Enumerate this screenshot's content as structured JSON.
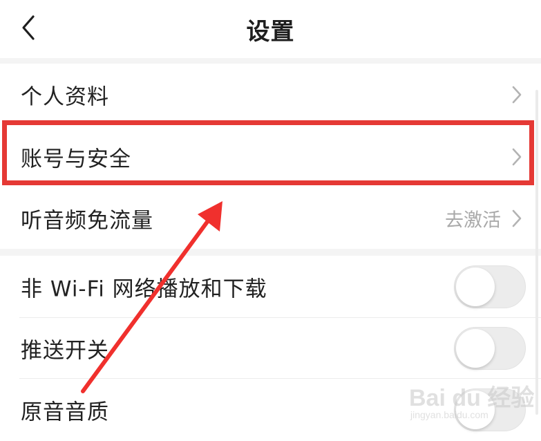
{
  "header": {
    "title": "设置",
    "back_icon": "chevron-left-icon"
  },
  "settings": {
    "profile": {
      "label": "个人资料"
    },
    "account_security": {
      "label": "账号与安全"
    },
    "audio_free_data": {
      "label": "听音频免流量",
      "value": "去激活"
    },
    "non_wifi_playback": {
      "label": "非 Wi-Fi 网络播放和下载",
      "enabled": false
    },
    "push_switch": {
      "label": "推送开关",
      "enabled": false
    },
    "original_sound_quality": {
      "label": "原音音质",
      "enabled": false
    }
  },
  "annotation": {
    "highlight_color": "#e53935",
    "highlighted_item": "账号与安全"
  },
  "watermark": {
    "main": "Bai du 经验",
    "sub": "jingyan.baidu.com"
  },
  "colors": {
    "secondary_text": "#a9a9a9",
    "separator_bg": "#f4f4f4",
    "toggle_off": "#ececec"
  }
}
